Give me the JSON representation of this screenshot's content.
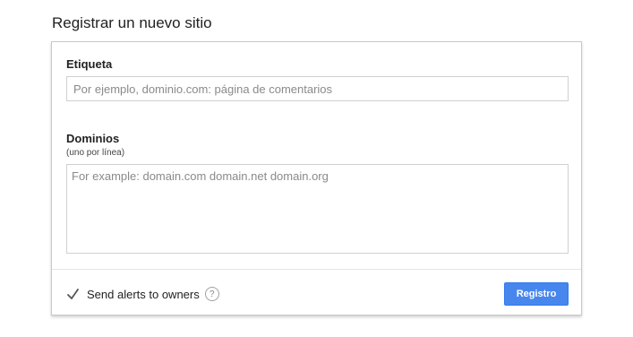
{
  "page": {
    "title": "Registrar un nuevo sitio"
  },
  "form": {
    "label_field": {
      "label": "Etiqueta",
      "placeholder": "Por ejemplo, dominio.com: página de comentarios",
      "value": ""
    },
    "domains_field": {
      "label": "Dominios",
      "hint": "(uno por línea)",
      "placeholder": "For example: domain.com domain.net domain.org",
      "value": ""
    },
    "alerts": {
      "label": "Send alerts to owners",
      "checked": true,
      "help_icon": "question-mark-icon",
      "help_glyph": "?"
    },
    "submit": {
      "label": "Registro"
    }
  },
  "colors": {
    "accent": "#4787ed",
    "border": "#d0d0d0",
    "text": "#222222"
  }
}
